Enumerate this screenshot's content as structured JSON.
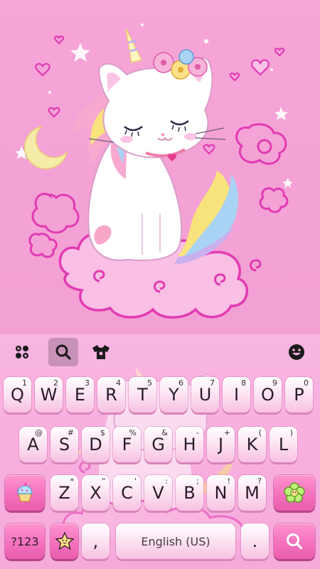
{
  "toolbar": {
    "icons": [
      "apps-grid-icon",
      "search-icon",
      "theme-shirt-icon",
      "emoji-smile-icon"
    ]
  },
  "rows": [
    {
      "keys": [
        {
          "label": "Q",
          "hint": "1"
        },
        {
          "label": "W",
          "hint": "2"
        },
        {
          "label": "E",
          "hint": "3"
        },
        {
          "label": "R",
          "hint": "4"
        },
        {
          "label": "T",
          "hint": "5"
        },
        {
          "label": "Y",
          "hint": "6"
        },
        {
          "label": "U",
          "hint": "7"
        },
        {
          "label": "I",
          "hint": "8"
        },
        {
          "label": "O",
          "hint": "9"
        },
        {
          "label": "P",
          "hint": "0"
        }
      ]
    },
    {
      "keys": [
        {
          "label": "A",
          "hint": "@"
        },
        {
          "label": "S",
          "hint": "#"
        },
        {
          "label": "D",
          "hint": "$"
        },
        {
          "label": "F",
          "hint": "%"
        },
        {
          "label": "G",
          "hint": "&"
        },
        {
          "label": "H",
          "hint": "-"
        },
        {
          "label": "J",
          "hint": "+"
        },
        {
          "label": "K",
          "hint": "("
        },
        {
          "label": "L",
          "hint": ")"
        }
      ]
    },
    {
      "keys": [
        {
          "label": "Z",
          "hint": "*"
        },
        {
          "label": "X",
          "hint": "\""
        },
        {
          "label": "C",
          "hint": "'"
        },
        {
          "label": "V",
          "hint": ":"
        },
        {
          "label": "B",
          "hint": ";"
        },
        {
          "label": "N",
          "hint": "!"
        },
        {
          "label": "M",
          "hint": "?"
        }
      ]
    }
  ],
  "bottom": {
    "symbols_label": "?123",
    "comma_label": ",",
    "space_label": "English (US)",
    "period_label": ".",
    "emoji_key_icon": "star-face-icon",
    "shift_key_icon": "cupcake-icon",
    "delete_key_icon": "flower-icon",
    "enter_key_icon": "search-icon"
  },
  "colors": {
    "background": "#f6a5d8",
    "key_face": "#fde6f3",
    "function_key": "#f472bd",
    "outline_magenta": "#e23bb4"
  }
}
